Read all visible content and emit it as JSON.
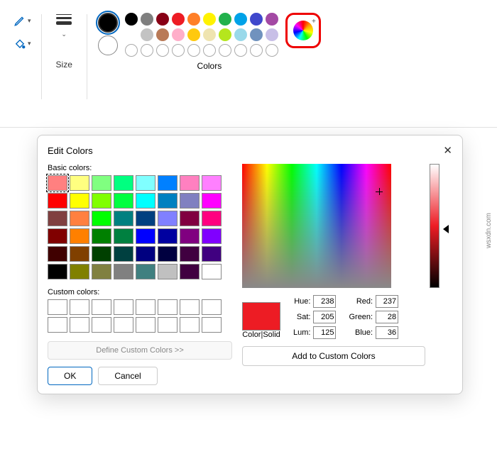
{
  "ribbon": {
    "size_label": "Size",
    "colors_label": "Colors",
    "current_color1": "#000000",
    "current_color2": "#ffffff",
    "palette_row1": [
      "#000000",
      "#7f7f7f",
      "#880015",
      "#ed1c24",
      "#ff7f27",
      "#fff200",
      "#22b14c",
      "#00a2e8",
      "#3f48cc",
      "#a349a4"
    ],
    "palette_row2": [
      "#ffffff",
      "#c3c3c3",
      "#b97a57",
      "#ffaec9",
      "#ffc90e",
      "#efe4b0",
      "#b5e61d",
      "#99d9ea",
      "#7092be",
      "#c8bfe7"
    ],
    "palette_row3_empty": 10
  },
  "dialog": {
    "title": "Edit Colors",
    "basic_label": "Basic colors:",
    "custom_label": "Custom colors:",
    "define_btn": "Define Custom Colors >>",
    "ok": "OK",
    "cancel": "Cancel",
    "preview_label": "Color|Solid",
    "preview_color": "#ed1c24",
    "hue_label": "Hue:",
    "hue": "238",
    "sat_label": "Sat:",
    "sat": "205",
    "lum_label": "Lum:",
    "lum": "125",
    "red_label": "Red:",
    "red": "237",
    "green_label": "Green:",
    "green": "28",
    "blue_label": "Blue:",
    "blue": "36",
    "add_btn": "Add to Custom Colors",
    "basic_colors": [
      "#ff8080",
      "#ffff80",
      "#80ff80",
      "#00ff80",
      "#80ffff",
      "#0080ff",
      "#ff80c0",
      "#ff80ff",
      "#ff0000",
      "#ffff00",
      "#80ff00",
      "#00ff40",
      "#00ffff",
      "#0080c0",
      "#8080c0",
      "#ff00ff",
      "#804040",
      "#ff8040",
      "#00ff00",
      "#008080",
      "#004080",
      "#8080ff",
      "#800040",
      "#ff0080",
      "#800000",
      "#ff8000",
      "#008000",
      "#008040",
      "#0000ff",
      "#0000a0",
      "#800080",
      "#8000ff",
      "#400000",
      "#804000",
      "#004000",
      "#004040",
      "#000080",
      "#000040",
      "#400040",
      "#400080",
      "#000000",
      "#808000",
      "#808040",
      "#808080",
      "#408080",
      "#c0c0c0",
      "#400040",
      "#ffffff"
    ]
  },
  "watermark": "wsxdn.com"
}
